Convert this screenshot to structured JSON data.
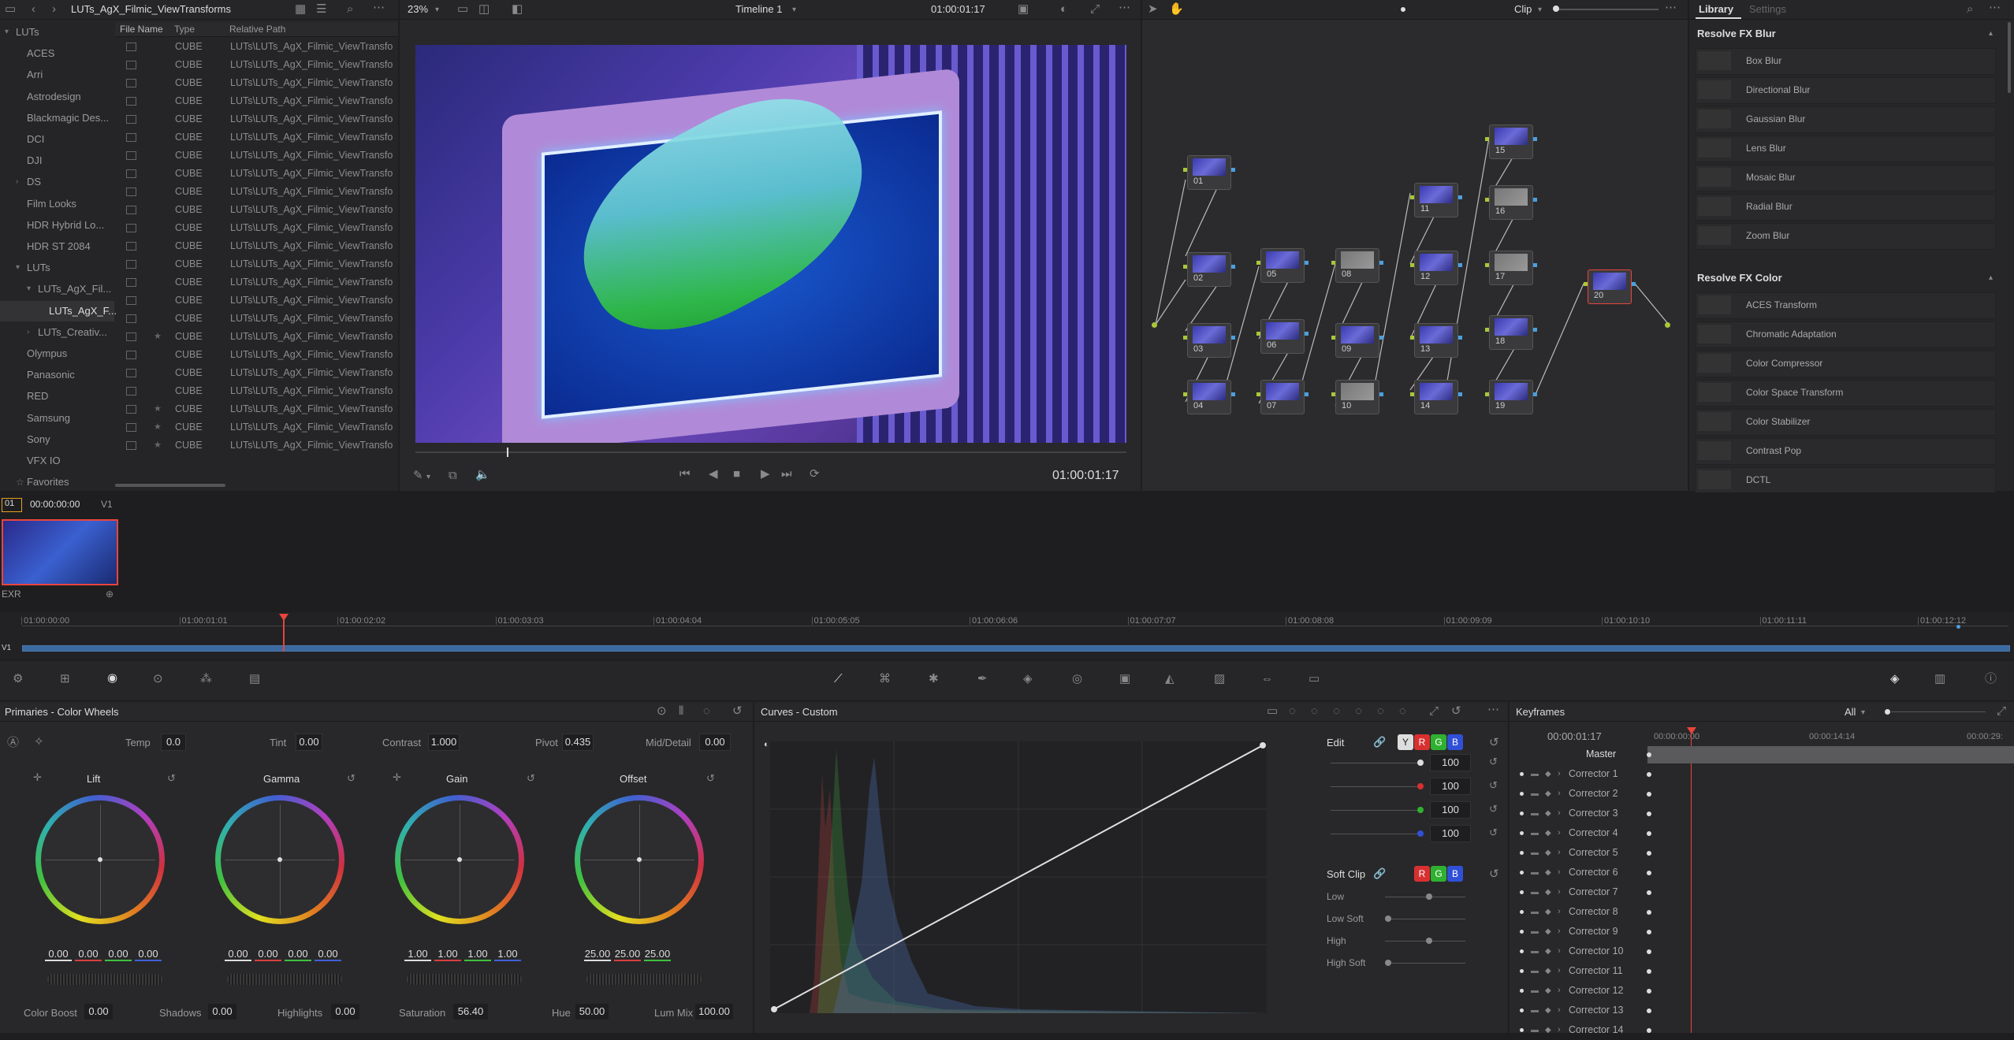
{
  "media_pool": {
    "path": "LUTs_AgX_Filmic_ViewTransforms",
    "columns": [
      "File Name",
      "Type",
      "Relative Path"
    ],
    "tree": [
      "LUTs",
      "ACES",
      "Arri",
      "Astrodesign",
      "Blackmagic Des...",
      "DCI",
      "DJI",
      "DS",
      "Film Looks",
      "HDR Hybrid Lo...",
      "HDR ST 2084",
      "LUTs",
      "LUTs_AgX_Fil...",
      "LUTs_AgX_F...",
      "LUTs_Creativ...",
      "Olympus",
      "Panasonic",
      "RED",
      "Samsung",
      "Sony",
      "VFX IO",
      "Favorites"
    ],
    "file_type": "CUBE",
    "file_path": "LUTs\\LUTs_AgX_Filmic_ViewTransfo",
    "file_count": 23
  },
  "viewer": {
    "zoom": "23%",
    "timeline_name": "Timeline 1",
    "timecode": "01:00:01:17",
    "playhead_timecode": "01:00:01:17"
  },
  "node_panel": {
    "mode": "Clip",
    "nodes": [
      "01",
      "02",
      "03",
      "04",
      "05",
      "06",
      "07",
      "08",
      "09",
      "10",
      "11",
      "12",
      "13",
      "14",
      "15",
      "16",
      "17",
      "18",
      "19",
      "20"
    ]
  },
  "library": {
    "tabs": [
      "Library",
      "Settings"
    ],
    "groups": [
      {
        "title": "Resolve FX Blur",
        "items": [
          "Box Blur",
          "Directional Blur",
          "Gaussian Blur",
          "Lens Blur",
          "Mosaic Blur",
          "Radial Blur",
          "Zoom Blur"
        ]
      },
      {
        "title": "Resolve FX Color",
        "items": [
          "ACES Transform",
          "Chromatic Adaptation",
          "Color Compressor",
          "Color Space Transform",
          "Color Stabilizer",
          "Contrast Pop",
          "DCTL"
        ]
      }
    ]
  },
  "clips": {
    "clip_number": "01",
    "clip_timecode": "00:00:00:00",
    "track": "V1",
    "clip_format": "EXR"
  },
  "timeline": {
    "timecodes": [
      "01:00:00:00",
      "01:00:01:01",
      "01:00:02:02",
      "01:00:03:03",
      "01:00:04:04",
      "01:00:05:05",
      "01:00:06:06",
      "01:00:07:07",
      "01:00:08:08",
      "01:00:09:09",
      "01:00:10:10",
      "01:00:11:11",
      "01:00:12:12"
    ],
    "track": "V1"
  },
  "primaries": {
    "title": "Primaries - Color Wheels",
    "top": {
      "temp_label": "Temp",
      "temp": "0.0",
      "tint_label": "Tint",
      "tint": "0.00",
      "contrast_label": "Contrast",
      "contrast": "1.000",
      "pivot_label": "Pivot",
      "pivot": "0.435",
      "middetail_label": "Mid/Detail",
      "middetail": "0.00"
    },
    "wheels": [
      {
        "name": "Lift",
        "values": [
          "0.00",
          "0.00",
          "0.00",
          "0.00"
        ]
      },
      {
        "name": "Gamma",
        "values": [
          "0.00",
          "0.00",
          "0.00",
          "0.00"
        ]
      },
      {
        "name": "Gain",
        "values": [
          "1.00",
          "1.00",
          "1.00",
          "1.00"
        ]
      },
      {
        "name": "Offset",
        "values": [
          "25.00",
          "25.00",
          "25.00"
        ]
      }
    ],
    "bottom": {
      "colorboost_label": "Color Boost",
      "colorboost": "0.00",
      "shadows_label": "Shadows",
      "shadows": "0.00",
      "highlights_label": "Highlights",
      "highlights": "0.00",
      "saturation_label": "Saturation",
      "saturation": "56.40",
      "hue_label": "Hue",
      "hue": "50.00",
      "lummix_label": "Lum Mix",
      "lummix": "100.00"
    }
  },
  "curves": {
    "title": "Curves - Custom",
    "edit_label": "Edit",
    "channels": [
      "Y",
      "R",
      "G",
      "B"
    ],
    "edit_values": [
      "100",
      "100",
      "100",
      "100"
    ],
    "soft_clip_label": "Soft Clip",
    "soft_clip_rows": [
      "Low",
      "Low Soft",
      "High",
      "High Soft"
    ]
  },
  "keyframes": {
    "title": "Keyframes",
    "filter": "All",
    "timecode": "00:00:01:17",
    "ruler": [
      "00:00:00:00",
      "00:00:14:14",
      "00:00:29:"
    ],
    "rows": [
      "Master",
      "Corrector 1",
      "Corrector 2",
      "Corrector 3",
      "Corrector 4",
      "Corrector 5",
      "Corrector 6",
      "Corrector 7",
      "Corrector 8",
      "Corrector 9",
      "Corrector 10",
      "Corrector 11",
      "Corrector 12",
      "Corrector 13",
      "Corrector 14"
    ]
  },
  "colors": {
    "accent": "#e8453c",
    "node_in": "#a8c838",
    "node_out": "#4aa0e0",
    "bg": "#1e1e20"
  }
}
